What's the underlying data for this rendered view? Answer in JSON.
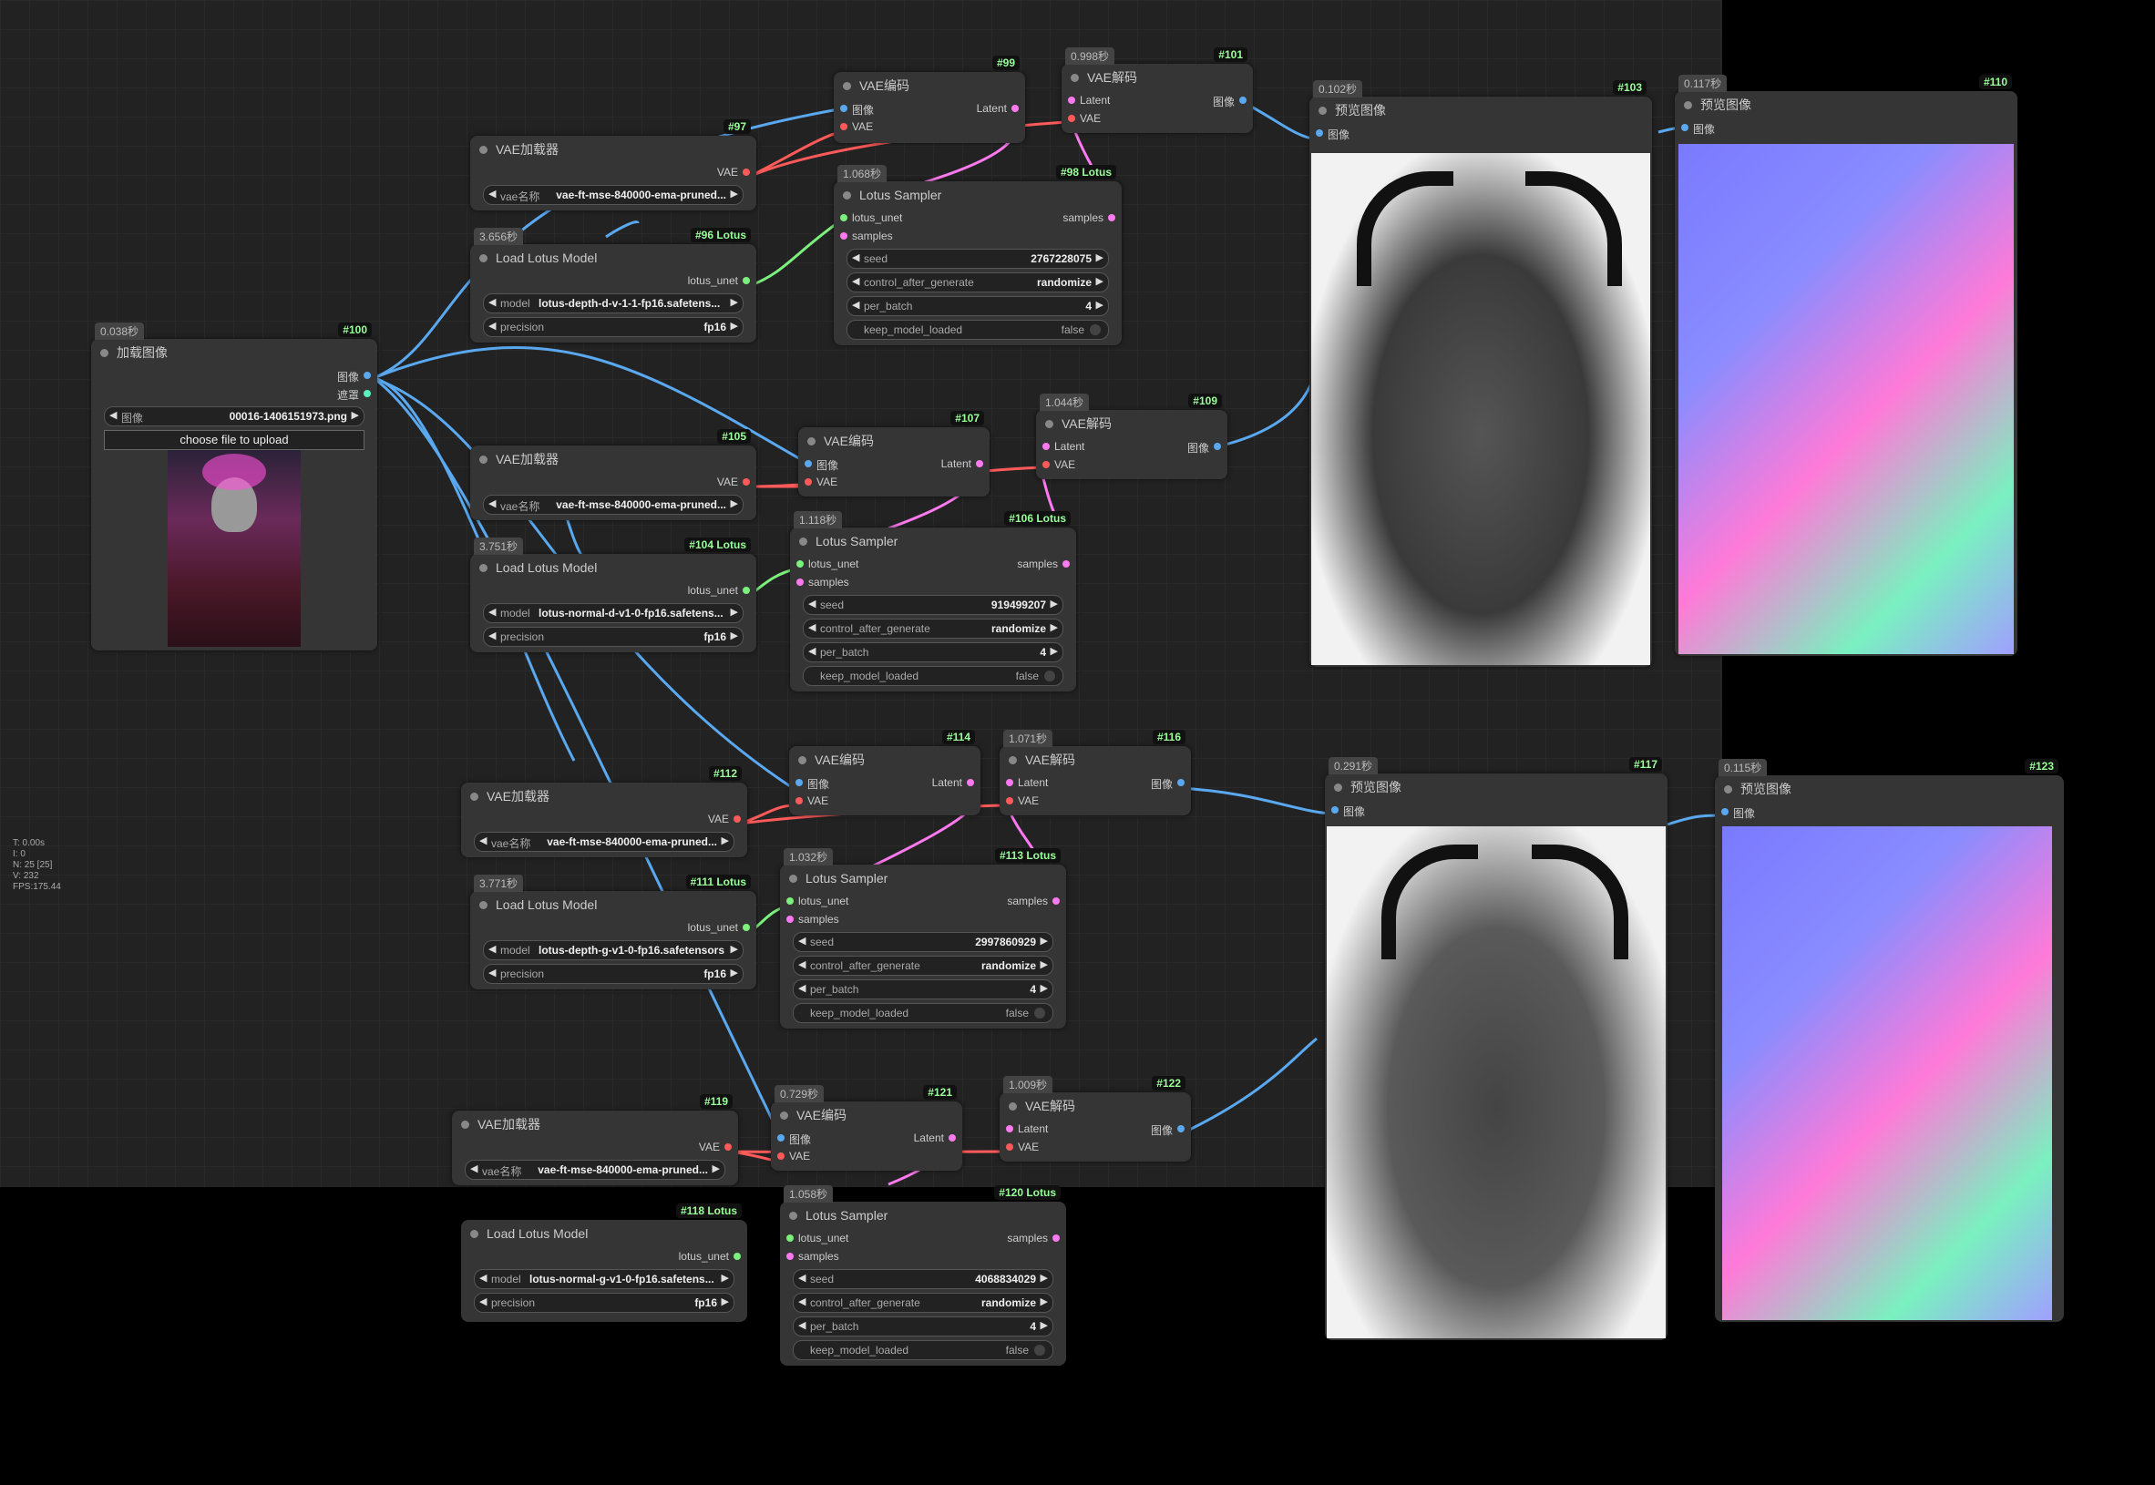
{
  "stats": [
    "T: 0.00s",
    "I: 0",
    "N: 25 [25]",
    "V: 232",
    "FPS:175.44"
  ],
  "nodes": {
    "n100": {
      "id": "#100",
      "time": "0.038秒",
      "title": "加载图像",
      "out1": "图像",
      "out2": "遮罩",
      "image_label": "图像",
      "image_value": "00016-1406151973.png",
      "upload": "choose file to upload"
    },
    "n97": {
      "id": "#97",
      "title": "VAE加载器",
      "out": "VAE",
      "w_label": "vae名称",
      "w_value": "vae-ft-mse-840000-ema-pruned..."
    },
    "n96": {
      "id": "#96 Lotus",
      "time": "3.656秒",
      "title": "Load Lotus Model",
      "out": "lotus_unet",
      "model_label": "model",
      "model_value": "lotus-depth-d-v-1-1-fp16.safetens...",
      "prec_label": "precision",
      "prec_value": "fp16"
    },
    "n99": {
      "id": "#99",
      "title": "VAE编码",
      "in1": "图像",
      "in2": "VAE",
      "out": "Latent"
    },
    "n101": {
      "id": "#101",
      "time": "0.998秒",
      "title": "VAE解码",
      "in1": "Latent",
      "in2": "VAE",
      "out": "图像"
    },
    "n98": {
      "id": "#98 Lotus",
      "time": "1.068秒",
      "title": "Lotus Sampler",
      "in1": "lotus_unet",
      "in2": "samples",
      "out": "samples",
      "seed_label": "seed",
      "seed": "2767228075",
      "cag_label": "control_after_generate",
      "cag": "randomize",
      "pb_label": "per_batch",
      "pb": "4",
      "kml_label": "keep_model_loaded",
      "kml": "false"
    },
    "n103": {
      "id": "#103",
      "time": "0.102秒",
      "title": "预览图像",
      "in": "图像"
    },
    "n110": {
      "id": "#110",
      "time": "0.117秒",
      "title": "预览图像",
      "in": "图像"
    },
    "n105": {
      "id": "#105",
      "title": "VAE加载器",
      "out": "VAE",
      "w_label": "vae名称",
      "w_value": "vae-ft-mse-840000-ema-pruned..."
    },
    "n104": {
      "id": "#104 Lotus",
      "time": "3.751秒",
      "title": "Load Lotus Model",
      "out": "lotus_unet",
      "model_label": "model",
      "model_value": "lotus-normal-d-v1-0-fp16.safetens...",
      "prec_label": "precision",
      "prec_value": "fp16"
    },
    "n107": {
      "id": "#107",
      "title": "VAE编码",
      "in1": "图像",
      "in2": "VAE",
      "out": "Latent"
    },
    "n109": {
      "id": "#109",
      "time": "1.044秒",
      "title": "VAE解码",
      "in1": "Latent",
      "in2": "VAE",
      "out": "图像"
    },
    "n106": {
      "id": "#106 Lotus",
      "time": "1.118秒",
      "title": "Lotus Sampler",
      "in1": "lotus_unet",
      "in2": "samples",
      "out": "samples",
      "seed_label": "seed",
      "seed": "919499207",
      "cag_label": "control_after_generate",
      "cag": "randomize",
      "pb_label": "per_batch",
      "pb": "4",
      "kml_label": "keep_model_loaded",
      "kml": "false"
    },
    "n112": {
      "id": "#112",
      "title": "VAE加载器",
      "out": "VAE",
      "w_label": "vae名称",
      "w_value": "vae-ft-mse-840000-ema-pruned..."
    },
    "n111": {
      "id": "#111 Lotus",
      "time": "3.771秒",
      "title": "Load Lotus Model",
      "out": "lotus_unet",
      "model_label": "model",
      "model_value": "lotus-depth-g-v1-0-fp16.safetensors",
      "prec_label": "precision",
      "prec_value": "fp16"
    },
    "n114": {
      "id": "#114",
      "title": "VAE编码",
      "in1": "图像",
      "in2": "VAE",
      "out": "Latent"
    },
    "n116": {
      "id": "#116",
      "time": "1.071秒",
      "title": "VAE解码",
      "in1": "Latent",
      "in2": "VAE",
      "out": "图像"
    },
    "n113": {
      "id": "#113 Lotus",
      "time": "1.032秒",
      "title": "Lotus Sampler",
      "in1": "lotus_unet",
      "in2": "samples",
      "out": "samples",
      "seed_label": "seed",
      "seed": "2997860929",
      "cag_label": "control_after_generate",
      "cag": "randomize",
      "pb_label": "per_batch",
      "pb": "4",
      "kml_label": "keep_model_loaded",
      "kml": "false"
    },
    "n117": {
      "id": "#117",
      "time": "0.291秒",
      "title": "预览图像",
      "in": "图像"
    },
    "n123": {
      "id": "#123",
      "time": "0.115秒",
      "title": "预览图像",
      "in": "图像"
    },
    "n119": {
      "id": "#119",
      "title": "VAE加载器",
      "out": "VAE",
      "w_label": "vae名称",
      "w_value": "vae-ft-mse-840000-ema-pruned..."
    },
    "n118": {
      "id": "#118 Lotus",
      "title": "Load Lotus Model",
      "out": "lotus_unet",
      "model_label": "model",
      "model_value": "lotus-normal-g-v1-0-fp16.safetens...",
      "prec_label": "precision",
      "prec_value": "fp16"
    },
    "n121": {
      "id": "#121",
      "time": "0.729秒",
      "title": "VAE编码",
      "in1": "图像",
      "in2": "VAE",
      "out": "Latent"
    },
    "n122": {
      "id": "#122",
      "time": "1.009秒",
      "title": "VAE解码",
      "in1": "Latent",
      "in2": "VAE",
      "out": "图像"
    },
    "n120": {
      "id": "#120 Lotus",
      "time": "1.058秒",
      "title": "Lotus Sampler",
      "in1": "lotus_unet",
      "in2": "samples",
      "out": "samples",
      "seed_label": "seed",
      "seed": "4068834029",
      "cag_label": "control_after_generate",
      "cag": "randomize",
      "pb_label": "per_batch",
      "pb": "4",
      "kml_label": "keep_model_loaded",
      "kml": "false"
    }
  }
}
